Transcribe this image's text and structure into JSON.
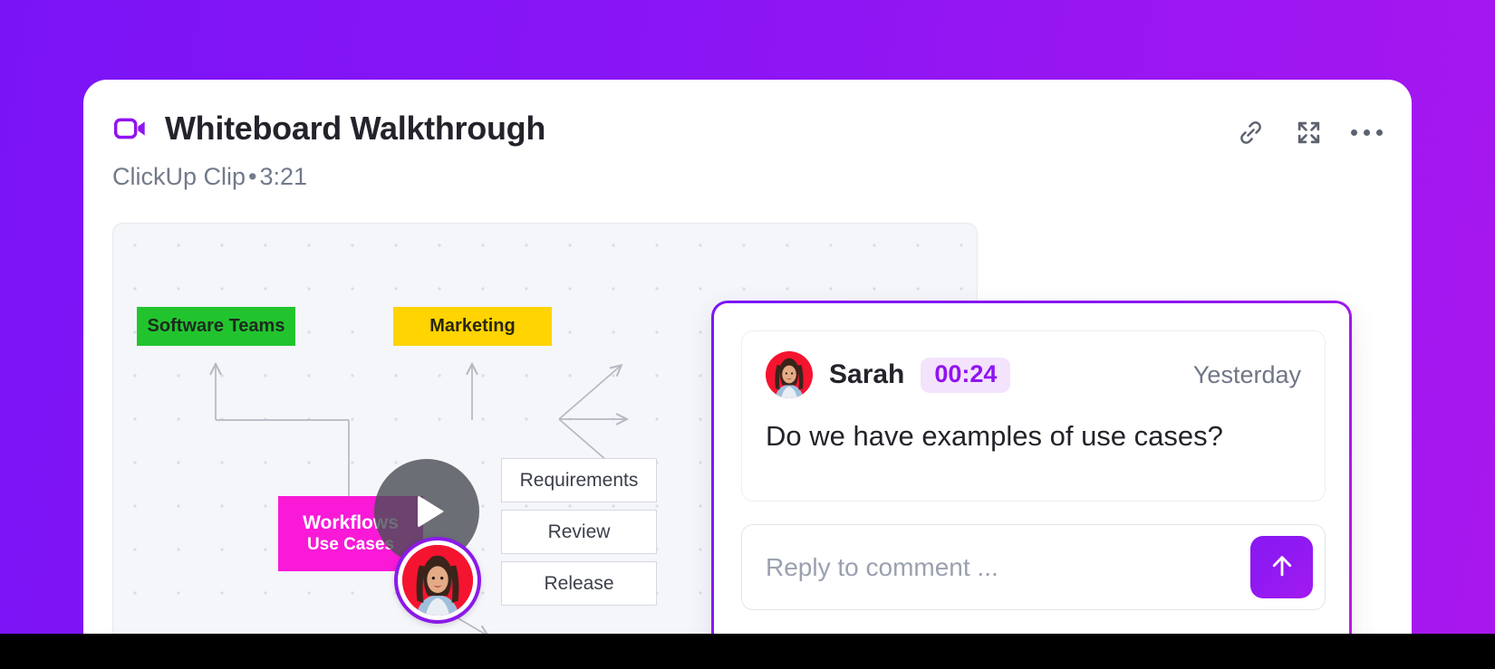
{
  "background": {
    "gradient_from": "#7a14f7",
    "gradient_to": "#a817ee"
  },
  "header": {
    "video_icon": "video-camera-icon",
    "title": "Whiteboard Walkthrough",
    "subtitle_source": "ClickUp Clip",
    "subtitle_separator": "•",
    "subtitle_duration": "3:21",
    "actions": [
      {
        "name": "copy-link-button",
        "icon": "link-icon"
      },
      {
        "name": "expand-button",
        "icon": "expand-icon"
      },
      {
        "name": "more-options-button",
        "icon": "ellipsis-icon"
      }
    ]
  },
  "whiteboard": {
    "notes": [
      {
        "id": "software",
        "label": "Software Teams",
        "color": "#22c42e"
      },
      {
        "id": "marketing",
        "label": "Marketing",
        "color": "#ffd400"
      },
      {
        "id": "workflows",
        "line1": "Workflows",
        "line2": "Use Cases",
        "color": "#f919d7"
      }
    ],
    "stage_boxes": [
      {
        "id": "requirement",
        "label": "Requirements"
      },
      {
        "id": "review",
        "label": "Review"
      },
      {
        "id": "release",
        "label": "Release"
      }
    ],
    "play_button_label": "play-icon",
    "pin_avatar_label": "sarah-avatar"
  },
  "comment": {
    "avatar_alt": "Sarah avatar",
    "author": "Sarah",
    "timestamp": "00:24",
    "timestamp_bg": "#f3e3fd",
    "timestamp_color": "#9013f0",
    "date": "Yesterday",
    "text": "Do we have examples of use cases?",
    "reply_placeholder": "Reply to comment ...",
    "reply_value": "",
    "send_icon": "arrow-up-icon",
    "send_color": "#8f19f2",
    "border_color": "#8c17f2"
  }
}
